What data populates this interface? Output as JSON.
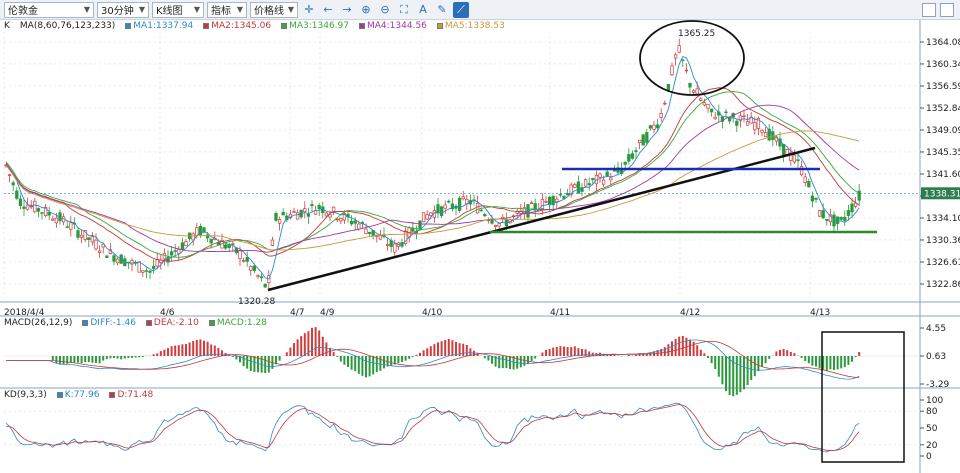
{
  "toolbar": {
    "product": "伦敦金",
    "period": "30分钟",
    "chart_type": "K线图",
    "indicator": "指标",
    "price_line": "价格线",
    "icons": [
      "crosshair-icon",
      "left-arrow-icon",
      "right-arrow-icon",
      "zoom-in-icon",
      "zoom-out-icon",
      "fit-icon",
      "text-icon",
      "draw-icon",
      "line-tool-icon"
    ]
  },
  "main_panel": {
    "label": "K",
    "ma_params": "MA(8,60,76,123,233)",
    "ma": [
      {
        "name": "MA1",
        "value": "1337.94",
        "color": "#2b8ac9"
      },
      {
        "name": "MA2",
        "value": "1345.06",
        "color": "#c23a3a"
      },
      {
        "name": "MA3",
        "value": "1346.97",
        "color": "#3aa83a"
      },
      {
        "name": "MA4",
        "value": "1344.56",
        "color": "#a03aa0"
      },
      {
        "name": "MA5",
        "value": "1338.53",
        "color": "#c69a3a"
      }
    ],
    "y_ticks": [
      "1364.08",
      "1360.34",
      "1356.59",
      "1352.84",
      "1349.09",
      "1345.35",
      "1341.60",
      "1337.85",
      "1334.10",
      "1330.36",
      "1326.61",
      "1322.86"
    ],
    "current_price": "1338.31",
    "high_label": "1365.25",
    "low_label": "1320.28",
    "x_ticks": [
      "2018/4/4",
      "4/6",
      "4/7",
      "4/9",
      "4/10",
      "4/11",
      "4/12",
      "4/13"
    ]
  },
  "macd_panel": {
    "params": "MACD(26,12,9)",
    "diff": "DIFF:-1.46",
    "dea": "DEA:-2.10",
    "macd": "MACD:1.28",
    "y_ticks": [
      "4.55",
      "0.63",
      "-3.29"
    ]
  },
  "kd_panel": {
    "params": "KD(9,3,3)",
    "k": "K:77.96",
    "d": "D:71.48",
    "y_ticks": [
      "100",
      "80",
      "50",
      "20",
      "0"
    ]
  },
  "colors": {
    "up": "#d23c3c",
    "down": "#2a9a3a",
    "grid": "#d8dde4"
  }
}
